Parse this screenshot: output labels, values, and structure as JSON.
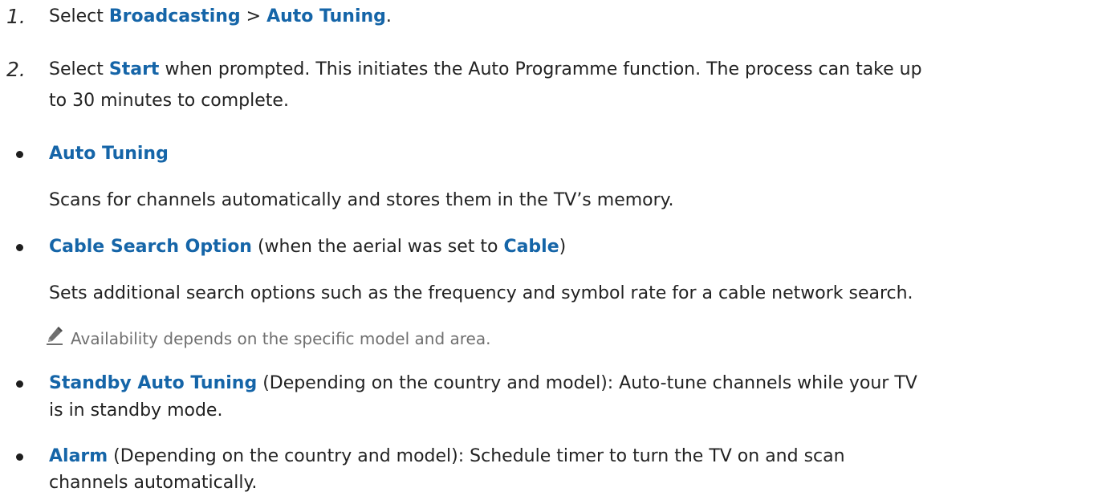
{
  "steps": [
    {
      "number": "1.",
      "parts": [
        "Select ",
        "Broadcasting",
        " > ",
        "Auto Tuning",
        "."
      ]
    },
    {
      "number": "2.",
      "parts": [
        "Select ",
        "Start",
        " when prompted. This initiates the Auto Programme function. The process can take up"
      ],
      "line2": "to 30 minutes to complete."
    }
  ],
  "items": [
    {
      "title": "Auto Tuning",
      "description": "Scans for channels automatically and stores them in the TV’s memory."
    },
    {
      "title": "Cable Search Option",
      "title_suffix": " (when the aerial was set to ",
      "title_highlight": "Cable",
      "title_end": ")",
      "description": "Sets additional search options such as the frequency and symbol rate for a cable network search.",
      "note": "Availability depends on the specific model and area."
    },
    {
      "title": "Standby Auto Tuning",
      "text": " (Depending on the country and model): Auto-tune channels while your TV",
      "line2": "is in standby mode."
    },
    {
      "title": "Alarm",
      "text": " (Depending on the country and model): Schedule timer to turn the TV on and scan",
      "line2": "channels automatically."
    }
  ],
  "icons": {
    "note_icon": "pencil-icon"
  },
  "colors": {
    "highlight": "#1565a8",
    "body_text": "#222222",
    "note_text": "#707070"
  }
}
